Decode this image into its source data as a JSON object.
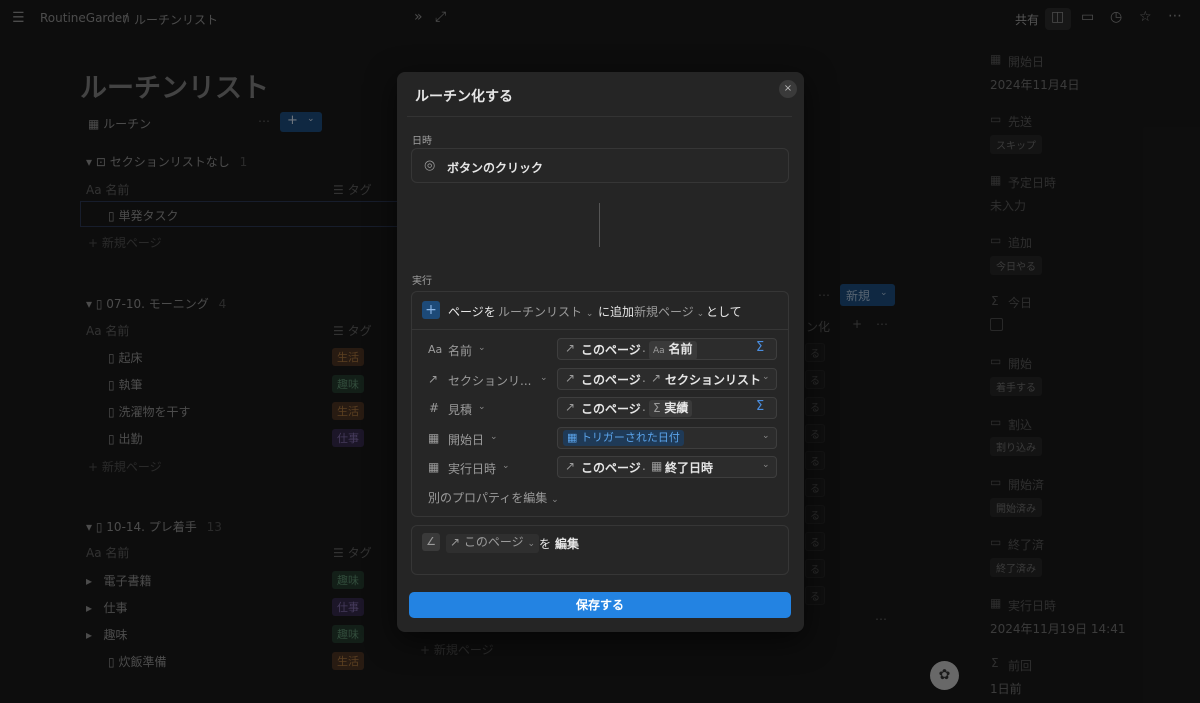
{
  "topbar": {
    "workspace": "RoutineGarden",
    "separator": "/",
    "page": "ルーチンリスト",
    "share": "共有"
  },
  "page": {
    "title": "ルーチンリスト",
    "view_name": "ルーチン",
    "add_button": "+"
  },
  "groups": [
    {
      "name": "セクションリストなし",
      "count": "1",
      "col_name": "名前",
      "col_tag": "タグ",
      "rows": [
        {
          "name": "単発タスク",
          "tag": ""
        }
      ],
      "new_page": "新規ページ"
    },
    {
      "name": "07-10. モーニング",
      "count": "4",
      "col_name": "名前",
      "col_tag": "タグ",
      "rows": [
        {
          "name": "起床",
          "tag": "生活"
        },
        {
          "name": "執筆",
          "tag": "趣味"
        },
        {
          "name": "洗濯物を干す",
          "tag": "生活"
        },
        {
          "name": "出勤",
          "tag": "仕事"
        }
      ],
      "new_page": "新規ページ"
    },
    {
      "name": "10-14. プレ着手",
      "count": "13",
      "col_name": "名前",
      "col_tag": "タグ",
      "rows": [
        {
          "name": "電子書籍",
          "tag": "趣味"
        },
        {
          "name": "仕事",
          "tag": "仕事"
        },
        {
          "name": "趣味",
          "tag": "趣味"
        },
        {
          "name": "炊飯準備",
          "tag": "生活"
        }
      ],
      "new_page": "新規ページ"
    }
  ],
  "side_table": {
    "header_partial": "ン化",
    "new_button": "新規",
    "row_chip": "る"
  },
  "right_panel": [
    {
      "label": "開始日",
      "value": "2024年11月4日"
    },
    {
      "label": "先送",
      "chip": "スキップ"
    },
    {
      "label": "予定日時",
      "value": "未入力"
    },
    {
      "label": "追加",
      "chip": "今日やる"
    },
    {
      "label": "今日",
      "checkbox": true
    },
    {
      "label": "開始",
      "chip": "着手する"
    },
    {
      "label": "割込",
      "chip": "割り込み"
    },
    {
      "label": "開始済",
      "chip": "開始済み"
    },
    {
      "label": "終了済",
      "chip": "終了済み"
    },
    {
      "label": "実行日時",
      "value": "2024年11月19日 14:41"
    },
    {
      "label": "前回",
      "value": "1日前"
    }
  ],
  "modal": {
    "title": "ルーチン化する",
    "close": "×",
    "trigger_label": "日時",
    "trigger_value": "ボタンのクリック",
    "action_label": "実行",
    "action": {
      "prefix": "ページを",
      "db": "ルーチンリスト",
      "mid": "に追加",
      "template": "新規ページ",
      "suffix": "として"
    },
    "props": [
      {
        "icon": "Aa",
        "name": "名前",
        "src": "このページ",
        "prop_icon": "Aa",
        "prop": "名前",
        "end": "Σ"
      },
      {
        "icon": "↗",
        "name": "セクションリ...",
        "src": "このページ",
        "prop_icon": "↗",
        "prop": "セクションリスト",
        "end": "⌄"
      },
      {
        "icon": "#",
        "name": "見積",
        "src": "このページ",
        "prop_icon": "Σ",
        "prop": "実績",
        "end": "Σ"
      },
      {
        "icon": "▦",
        "name": "開始日",
        "src": "",
        "prop_icon": "▦",
        "prop": "トリガーされた日付",
        "end": "⌄"
      },
      {
        "icon": "▦",
        "name": "実行日時",
        "src": "このページ",
        "prop_icon": "▦",
        "prop": "終了日時",
        "end": "⌄"
      }
    ],
    "edit_other": "別のプロパティを編集",
    "edit_action": {
      "page": "このページ",
      "wo": "を",
      "verb": "編集"
    },
    "save": "保存する"
  },
  "colors": {
    "accent": "#2383e2",
    "background": "#191919",
    "modal": "#252525"
  }
}
